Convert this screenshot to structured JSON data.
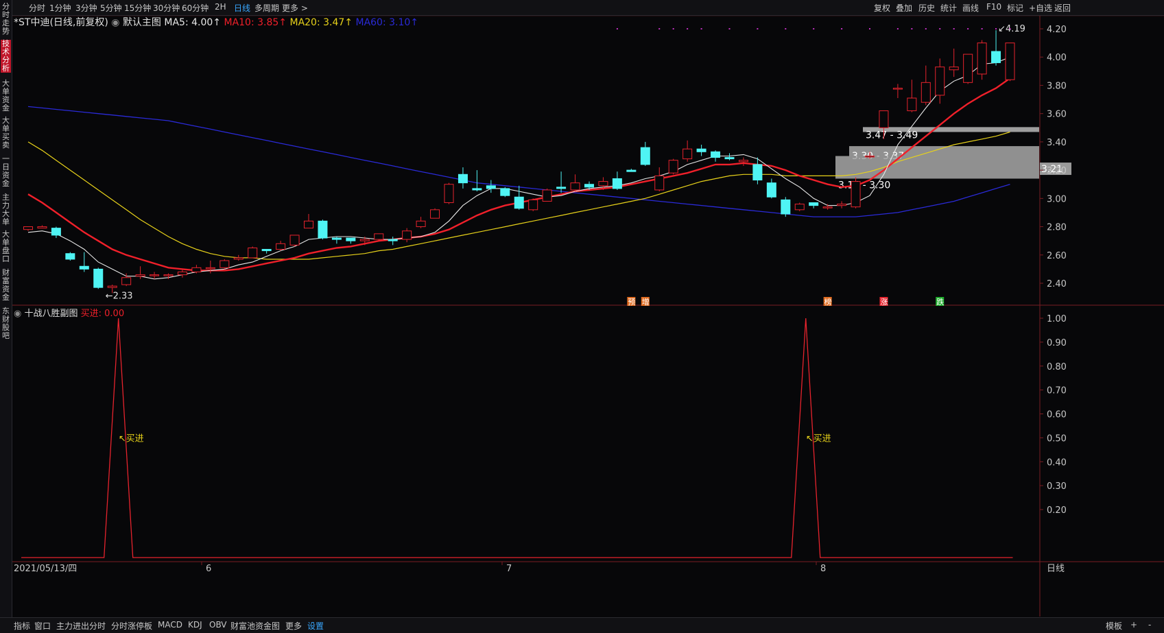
{
  "toolbar": {
    "periods": [
      "分时",
      "1分钟",
      "3分钟",
      "5分钟",
      "15分钟",
      "30分钟",
      "60分钟",
      "2H",
      "日线",
      "多周期",
      "更多 >"
    ],
    "active_period": "日线",
    "right_tools": [
      "复权",
      "叠加",
      "历史",
      "统计",
      "画线",
      "F10",
      "标记",
      "+自选",
      "返回"
    ]
  },
  "left_nav": [
    "分时走势",
    "技术分析",
    "大单资金",
    "大单买卖",
    "一日资金",
    "主力大单",
    "大单盘口",
    "财富资金",
    "东财股吧"
  ],
  "main_legend": {
    "stock": "*ST中迪(日线,前复权)",
    "template": "默认主图",
    "ma5": "MA5: 4.00↑",
    "ma10": "MA10: 3.85↑",
    "ma20": "MA20: 3.47↑",
    "ma60": "MA60: 3.10↑"
  },
  "sub_legend": {
    "name": "十战八胜副图",
    "value": "买进: 0.00"
  },
  "colors": {
    "up": "#e6232d",
    "down": "#4ff4f4",
    "ma5": "#e8e8e8",
    "ma10": "#f0202a",
    "ma20": "#e8d21a",
    "ma60": "#2a2ad8",
    "bg": "#070709"
  },
  "chart_data": {
    "type": "candlestick",
    "main_y_ticks": [
      "4.20",
      "4.00",
      "3.80",
      "3.60",
      "3.40",
      "3.20",
      "3.00",
      "2.80",
      "2.60",
      "2.40"
    ],
    "sub_y_ticks": [
      "1.00",
      "0.90",
      "0.80",
      "0.70",
      "0.60",
      "0.50",
      "0.40",
      "0.30",
      "0.20"
    ],
    "x_labels": [
      "2021/05/13/四",
      "6",
      "7",
      "8"
    ],
    "period_label": "日线",
    "last_price": "3.21",
    "extreme_labels": {
      "low": "2.33",
      "high": "4.19"
    },
    "price_zones": [
      {
        "label": "3.47 - 3.49",
        "low": 3.47,
        "high": 3.49
      },
      {
        "label": "3.30 - 3.37",
        "low": 3.3,
        "high": 3.37
      },
      {
        "label": "3.14 - 3.30",
        "low": 3.14,
        "high": 3.3
      }
    ],
    "markers": [
      "预",
      "增",
      "榜",
      "涨",
      "跌"
    ],
    "buy_signal_label": "买进",
    "candles": [
      [
        2.78,
        2.8,
        2.77,
        2.79
      ],
      [
        2.79,
        2.8,
        2.79,
        2.81
      ],
      [
        2.79,
        2.74,
        2.72,
        2.8
      ],
      [
        2.61,
        2.57,
        2.56,
        2.62
      ],
      [
        2.52,
        2.5,
        2.48,
        2.62
      ],
      [
        2.5,
        2.37,
        2.36,
        2.51
      ],
      [
        2.37,
        2.38,
        2.33,
        2.39
      ],
      [
        2.39,
        2.44,
        2.38,
        2.47
      ],
      [
        2.45,
        2.46,
        2.43,
        2.52
      ],
      [
        2.46,
        2.46,
        2.43,
        2.48
      ],
      [
        2.46,
        2.46,
        2.43,
        2.47
      ],
      [
        2.46,
        2.48,
        2.44,
        2.5
      ],
      [
        2.48,
        2.51,
        2.47,
        2.53
      ],
      [
        2.51,
        2.51,
        2.47,
        2.56
      ],
      [
        2.51,
        2.56,
        2.5,
        2.57
      ],
      [
        2.57,
        2.58,
        2.56,
        2.6
      ],
      [
        2.58,
        2.65,
        2.58,
        2.66
      ],
      [
        2.64,
        2.63,
        2.61,
        2.64
      ],
      [
        2.64,
        2.68,
        2.63,
        2.7
      ],
      [
        2.67,
        2.74,
        2.66,
        2.74
      ],
      [
        2.79,
        2.84,
        2.79,
        2.89
      ],
      [
        2.84,
        2.72,
        2.71,
        2.85
      ],
      [
        2.72,
        2.71,
        2.68,
        2.73
      ],
      [
        2.72,
        2.7,
        2.68,
        2.71
      ],
      [
        2.7,
        2.71,
        2.67,
        2.73
      ],
      [
        2.71,
        2.75,
        2.7,
        2.75
      ],
      [
        2.71,
        2.7,
        2.67,
        2.73
      ],
      [
        2.71,
        2.77,
        2.69,
        2.79
      ],
      [
        2.8,
        2.84,
        2.79,
        2.87
      ],
      [
        2.86,
        2.92,
        2.86,
        2.93
      ],
      [
        2.97,
        3.1,
        2.96,
        3.11
      ],
      [
        3.17,
        3.11,
        3.07,
        3.22
      ],
      [
        3.07,
        3.06,
        3.05,
        3.2
      ],
      [
        3.09,
        3.07,
        3.04,
        3.13
      ],
      [
        3.07,
        3.02,
        3.01,
        3.08
      ],
      [
        3.01,
        2.93,
        2.92,
        3.09
      ],
      [
        2.92,
        2.99,
        2.91,
        3.0
      ],
      [
        2.98,
        3.06,
        2.98,
        3.07
      ],
      [
        3.08,
        3.07,
        3.04,
        3.19
      ],
      [
        3.06,
        3.11,
        3.05,
        3.17
      ],
      [
        3.1,
        3.08,
        3.06,
        3.12
      ],
      [
        3.09,
        3.12,
        3.06,
        3.15
      ],
      [
        3.14,
        3.07,
        3.06,
        3.19
      ],
      [
        3.2,
        3.19,
        3.19,
        3.21
      ],
      [
        3.36,
        3.24,
        3.23,
        3.4
      ],
      [
        3.06,
        3.16,
        3.05,
        3.22
      ],
      [
        3.18,
        3.27,
        3.17,
        3.28
      ],
      [
        3.28,
        3.35,
        3.26,
        3.41
      ],
      [
        3.35,
        3.33,
        3.3,
        3.38
      ],
      [
        3.33,
        3.29,
        3.26,
        3.34
      ],
      [
        3.29,
        3.28,
        3.27,
        3.32
      ],
      [
        3.26,
        3.27,
        3.23,
        3.29
      ],
      [
        3.24,
        3.13,
        3.1,
        3.29
      ],
      [
        3.11,
        3.01,
        3.0,
        3.14
      ],
      [
        2.99,
        2.89,
        2.87,
        3.01
      ],
      [
        2.92,
        2.96,
        2.91,
        2.97
      ],
      [
        2.97,
        2.95,
        2.93,
        2.97
      ],
      [
        2.94,
        2.94,
        2.92,
        2.96
      ],
      [
        2.95,
        2.96,
        2.93,
        2.98
      ],
      [
        2.94,
        3.12,
        2.93,
        3.15
      ],
      [
        3.3,
        3.3,
        3.28,
        3.33
      ],
      [
        3.5,
        3.62,
        3.42,
        3.62
      ],
      [
        3.78,
        3.78,
        3.71,
        3.81
      ],
      [
        3.62,
        3.71,
        3.61,
        3.84
      ],
      [
        3.68,
        3.82,
        3.66,
        3.94
      ],
      [
        3.73,
        3.93,
        3.67,
        3.99
      ],
      [
        3.91,
        3.93,
        3.86,
        4.06
      ],
      [
        3.82,
        4.02,
        3.81,
        4.02
      ],
      [
        3.88,
        4.1,
        3.84,
        4.12
      ],
      [
        4.04,
        3.96,
        3.94,
        4.19
      ],
      [
        3.84,
        4.1,
        3.83,
        4.1
      ]
    ],
    "ma5": [
      2.76,
      2.77,
      2.75,
      2.7,
      2.64,
      2.55,
      2.5,
      2.45,
      2.45,
      2.43,
      2.44,
      2.46,
      2.48,
      2.49,
      2.5,
      2.53,
      2.55,
      2.59,
      2.63,
      2.66,
      2.71,
      2.72,
      2.73,
      2.73,
      2.72,
      2.71,
      2.71,
      2.72,
      2.73,
      2.76,
      2.84,
      2.95,
      3.02,
      3.07,
      3.07,
      3.05,
      3.03,
      3.01,
      3.02,
      3.05,
      3.07,
      3.08,
      3.09,
      3.11,
      3.14,
      3.16,
      3.19,
      3.24,
      3.27,
      3.3,
      3.3,
      3.31,
      3.28,
      3.21,
      3.14,
      3.08,
      3.0,
      2.95,
      2.95,
      2.97,
      3.02,
      3.17,
      3.38,
      3.51,
      3.64,
      3.76,
      3.83,
      3.87,
      3.95,
      3.96,
      4.0
    ],
    "ma10": [
      3.03,
      2.97,
      2.9,
      2.83,
      2.76,
      2.7,
      2.64,
      2.6,
      2.57,
      2.54,
      2.51,
      2.5,
      2.49,
      2.49,
      2.49,
      2.5,
      2.52,
      2.54,
      2.56,
      2.58,
      2.61,
      2.63,
      2.65,
      2.66,
      2.68,
      2.7,
      2.71,
      2.72,
      2.73,
      2.75,
      2.78,
      2.83,
      2.88,
      2.92,
      2.95,
      2.97,
      2.99,
      3.01,
      3.03,
      3.05,
      3.06,
      3.07,
      3.08,
      3.1,
      3.12,
      3.14,
      3.16,
      3.18,
      3.21,
      3.24,
      3.24,
      3.25,
      3.24,
      3.23,
      3.2,
      3.16,
      3.13,
      3.1,
      3.08,
      3.09,
      3.13,
      3.2,
      3.28,
      3.36,
      3.44,
      3.52,
      3.6,
      3.67,
      3.73,
      3.78,
      3.85
    ],
    "ma20": [
      3.4,
      3.34,
      3.27,
      3.2,
      3.13,
      3.06,
      2.99,
      2.92,
      2.85,
      2.79,
      2.73,
      2.68,
      2.64,
      2.61,
      2.59,
      2.58,
      2.58,
      2.57,
      2.57,
      2.57,
      2.57,
      2.58,
      2.59,
      2.6,
      2.61,
      2.63,
      2.64,
      2.66,
      2.68,
      2.7,
      2.72,
      2.74,
      2.76,
      2.78,
      2.8,
      2.82,
      2.84,
      2.86,
      2.88,
      2.9,
      2.92,
      2.94,
      2.96,
      2.98,
      3.0,
      3.03,
      3.06,
      3.09,
      3.12,
      3.14,
      3.16,
      3.17,
      3.17,
      3.17,
      3.16,
      3.16,
      3.16,
      3.16,
      3.16,
      3.17,
      3.19,
      3.22,
      3.26,
      3.29,
      3.32,
      3.35,
      3.38,
      3.4,
      3.42,
      3.44,
      3.47
    ],
    "ma60": [
      3.65,
      3.64,
      3.63,
      3.62,
      3.61,
      3.6,
      3.59,
      3.58,
      3.57,
      3.56,
      3.55,
      3.53,
      3.51,
      3.49,
      3.47,
      3.45,
      3.43,
      3.41,
      3.39,
      3.37,
      3.35,
      3.33,
      3.31,
      3.29,
      3.27,
      3.25,
      3.23,
      3.21,
      3.19,
      3.17,
      3.15,
      3.13,
      3.11,
      3.1,
      3.09,
      3.08,
      3.07,
      3.06,
      3.05,
      3.04,
      3.03,
      3.02,
      3.01,
      3.0,
      2.99,
      2.98,
      2.97,
      2.96,
      2.95,
      2.94,
      2.93,
      2.92,
      2.91,
      2.9,
      2.89,
      2.88,
      2.87,
      2.87,
      2.87,
      2.87,
      2.88,
      2.89,
      2.9,
      2.92,
      2.94,
      2.96,
      2.98,
      3.01,
      3.04,
      3.07,
      3.1
    ],
    "sub_signal_spikes": [
      6,
      55
    ]
  },
  "statusbar": {
    "tabs": [
      "指标",
      "窗口",
      "主力进出分时",
      "分时涨停板",
      "MACD",
      "KDJ",
      "OBV",
      "财富池资金图",
      "更多",
      "设置"
    ],
    "active_tab": "设置",
    "right": [
      "模板",
      "+",
      "-"
    ]
  }
}
